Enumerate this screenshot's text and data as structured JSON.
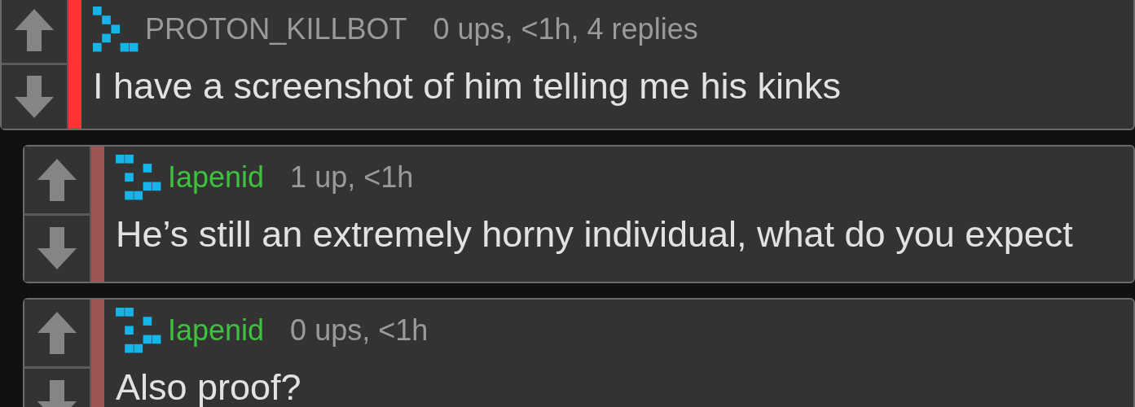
{
  "comments": [
    {
      "color": "#ff3333",
      "author": {
        "name": "PROTON_KILLBOT",
        "color": "#9a9a9a"
      },
      "meta": "0 ups, <1h, 4 replies",
      "text": "I have a screenshot of him telling me his kinks",
      "children": [
        {
          "color": "#a05555",
          "author": {
            "name": "Iapenid",
            "color": "#3ec23e"
          },
          "meta": "1 up, <1h",
          "text": "He’s still an extremely horny individual, what do you expect"
        },
        {
          "color": "#a05555",
          "author": {
            "name": "Iapenid",
            "color": "#3ec23e"
          },
          "meta": "0 ups, <1h",
          "text": "Also proof?"
        }
      ]
    }
  ]
}
